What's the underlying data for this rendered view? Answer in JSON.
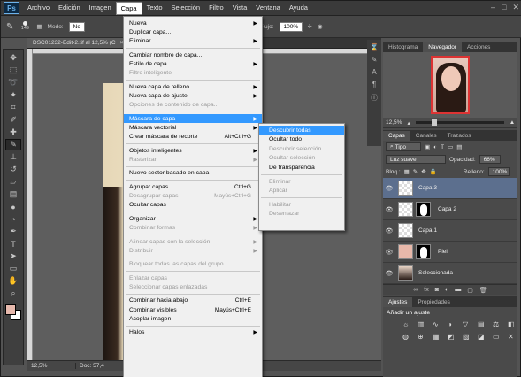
{
  "app": {
    "logo": "Ps"
  },
  "menubar": [
    "Archivo",
    "Edición",
    "Imagen",
    "Capa",
    "Texto",
    "Selección",
    "Filtro",
    "Vista",
    "Ventana",
    "Ayuda"
  ],
  "options": {
    "size": "149",
    "mode_label": "Modo:",
    "mode_value": "No",
    "flow_label": "Flujo:",
    "flow_value": "100%"
  },
  "document": {
    "tab_title": "DSC01232-Edit-2.tif al 12,5% (C",
    "close": "×",
    "zoom": "12,5%",
    "doc_info": "Doc: 57,4"
  },
  "capa_menu": [
    {
      "label": "Nueva",
      "arrow": true
    },
    {
      "label": "Duplicar capa..."
    },
    {
      "label": "Eliminar",
      "arrow": true
    },
    {
      "sep": true
    },
    {
      "label": "Cambiar nombre de capa..."
    },
    {
      "label": "Estilo de capa",
      "arrow": true
    },
    {
      "label": "Filtro inteligente",
      "disabled": true
    },
    {
      "sep": true
    },
    {
      "label": "Nueva capa de relleno",
      "arrow": true
    },
    {
      "label": "Nueva capa de ajuste",
      "arrow": true
    },
    {
      "label": "Opciones de contenido de capa...",
      "disabled": true
    },
    {
      "sep": true
    },
    {
      "label": "Máscara de capa",
      "arrow": true,
      "highlighted": true
    },
    {
      "label": "Máscara vectorial",
      "arrow": true
    },
    {
      "label": "Crear máscara de recorte",
      "shortcut": "Alt+Ctrl+G"
    },
    {
      "sep": true
    },
    {
      "label": "Objetos inteligentes",
      "arrow": true
    },
    {
      "label": "Rasterizar",
      "arrow": true,
      "disabled": true
    },
    {
      "sep": true
    },
    {
      "label": "Nuevo sector basado en capa"
    },
    {
      "sep": true
    },
    {
      "label": "Agrupar capas",
      "shortcut": "Ctrl+G"
    },
    {
      "label": "Desagrupar capas",
      "shortcut": "Mayús+Ctrl+G",
      "disabled": true
    },
    {
      "label": "Ocultar capas"
    },
    {
      "sep": true
    },
    {
      "label": "Organizar",
      "arrow": true
    },
    {
      "label": "Combinar formas",
      "arrow": true,
      "disabled": true
    },
    {
      "sep": true
    },
    {
      "label": "Alinear capas con la selección",
      "arrow": true,
      "disabled": true
    },
    {
      "label": "Distribuir",
      "arrow": true,
      "disabled": true
    },
    {
      "sep": true
    },
    {
      "label": "Bloquear todas las capas del grupo...",
      "disabled": true
    },
    {
      "sep": true
    },
    {
      "label": "Enlazar capas",
      "disabled": true
    },
    {
      "label": "Seleccionar capas enlazadas",
      "disabled": true
    },
    {
      "sep": true
    },
    {
      "label": "Combinar hacia abajo",
      "shortcut": "Ctrl+E"
    },
    {
      "label": "Combinar visibles",
      "shortcut": "Mayús+Ctrl+E"
    },
    {
      "label": "Acoplar imagen"
    },
    {
      "sep": true
    },
    {
      "label": "Halos",
      "arrow": true
    }
  ],
  "mask_submenu": [
    {
      "label": "Descubrir todas",
      "highlighted": true
    },
    {
      "label": "Ocultar todo"
    },
    {
      "label": "Descubrir selección",
      "disabled": true
    },
    {
      "label": "Ocultar selección",
      "disabled": true
    },
    {
      "label": "De transparencia"
    },
    {
      "sep": true
    },
    {
      "label": "Eliminar",
      "disabled": true
    },
    {
      "label": "Aplicar",
      "disabled": true
    },
    {
      "sep": true
    },
    {
      "label": "Habilitar",
      "disabled": true
    },
    {
      "label": "Desenlazar",
      "disabled": true
    }
  ],
  "navigator": {
    "tabs": [
      "Histograma",
      "Navegador",
      "Acciones"
    ],
    "active": "Navegador",
    "zoom": "12,5%"
  },
  "layers_panel": {
    "tabs": [
      "Capas",
      "Canales",
      "Trazados"
    ],
    "filter": "Tipo",
    "blend": "Luz suave",
    "opacity_label": "Opacidad:",
    "opacity": "66%",
    "lock_label": "Bloq.:",
    "fill_label": "Relleno:",
    "fill": "100%",
    "layers": [
      {
        "name": "Capa 3",
        "selected": true,
        "thumb": "checker",
        "mask": false
      },
      {
        "name": "Capa 2",
        "selected": false,
        "thumb": "checker",
        "mask": true
      },
      {
        "name": "Capa 1",
        "selected": false,
        "thumb": "checker",
        "mask": false
      },
      {
        "name": "Piel",
        "selected": false,
        "thumb": "skin",
        "mask": true
      },
      {
        "name": "Seleccionada",
        "selected": false,
        "thumb": "photo",
        "mask": false
      }
    ]
  },
  "adjustments": {
    "tabs": [
      "Ajustes",
      "Propiedades"
    ],
    "title": "Añadir un ajuste"
  },
  "colors": {
    "foreground": "#e7b9ad",
    "background": "#ffffff",
    "highlight": "#3399ff"
  }
}
